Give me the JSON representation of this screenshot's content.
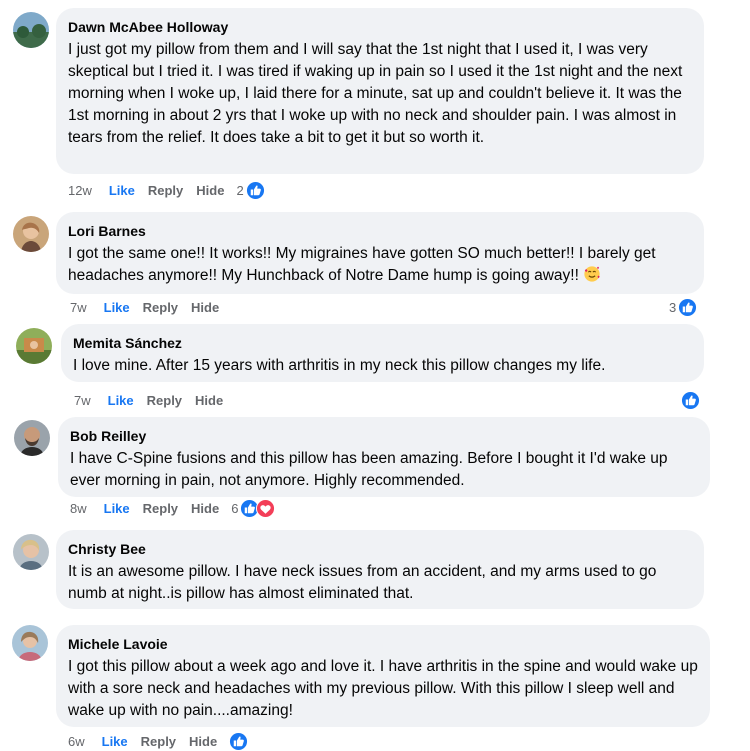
{
  "comments": [
    {
      "name": "Dawn McAbee Holloway",
      "text": "I just got my pillow from them and I will say that the 1st night that I used it, I was very skeptical but I tried it. I was tired if waking up in pain so I used it the 1st night and the next morning when I woke up, I laid there for a minute, sat up and couldn't believe it. It was the 1st morning in about 2 yrs that I woke up with no neck and shoulder pain. I was almost in tears from the relief. It does take a bit to get it but so worth it.",
      "time": "12w",
      "like": "Like",
      "reply": "Reply",
      "hide": "Hide",
      "reaction_count": "2"
    },
    {
      "name": "Lori Barnes",
      "text": "I got the same one!! It works!! My migraines have gotten SO much better!! I barely get headaches anymore!! My Hunchback of Notre Dame hump is going away!!",
      "emoji": "smiling-face-with-hearts-emoji",
      "time": "7w",
      "like": "Like",
      "reply": "Reply",
      "hide": "Hide",
      "reaction_count": "3"
    },
    {
      "name": "Memita Sánchez",
      "text": "I love mine. After 15 years with arthritis in my neck this pillow changes my life.",
      "time": "7w",
      "like": "Like",
      "reply": "Reply",
      "hide": "Hide",
      "reaction_count": ""
    },
    {
      "name": "Bob Reilley",
      "text": "I have C-Spine fusions and this pillow has been amazing. Before I bought it I'd wake up ever morning in pain, not anymore. Highly recommended.",
      "time": "8w",
      "like": "Like",
      "reply": "Reply",
      "hide": "Hide",
      "reaction_count": "6"
    },
    {
      "name": "Christy Bee",
      "text": "It is an awesome pillow. I have neck issues from an accident, and my arms used to go numb at night..is pillow has almost eliminated that."
    },
    {
      "name": "Michele Lavoie",
      "text": "I got this pillow about a week ago and love it. I have arthritis in the spine and would wake up with a sore neck and headaches with my previous pillow. With this pillow I sleep well and wake up with no pain....amazing!",
      "time": "6w",
      "like": "Like",
      "reply": "Reply",
      "hide": "Hide",
      "reaction_count": ""
    }
  ],
  "icons": {
    "like_reaction": "like-thumb-icon",
    "love_reaction": "love-heart-icon"
  },
  "colors": {
    "like_blue": "#1877f2",
    "love_red": "#f33e58",
    "bubble_gray": "#f0f2f5",
    "meta_gray": "#65676b"
  }
}
